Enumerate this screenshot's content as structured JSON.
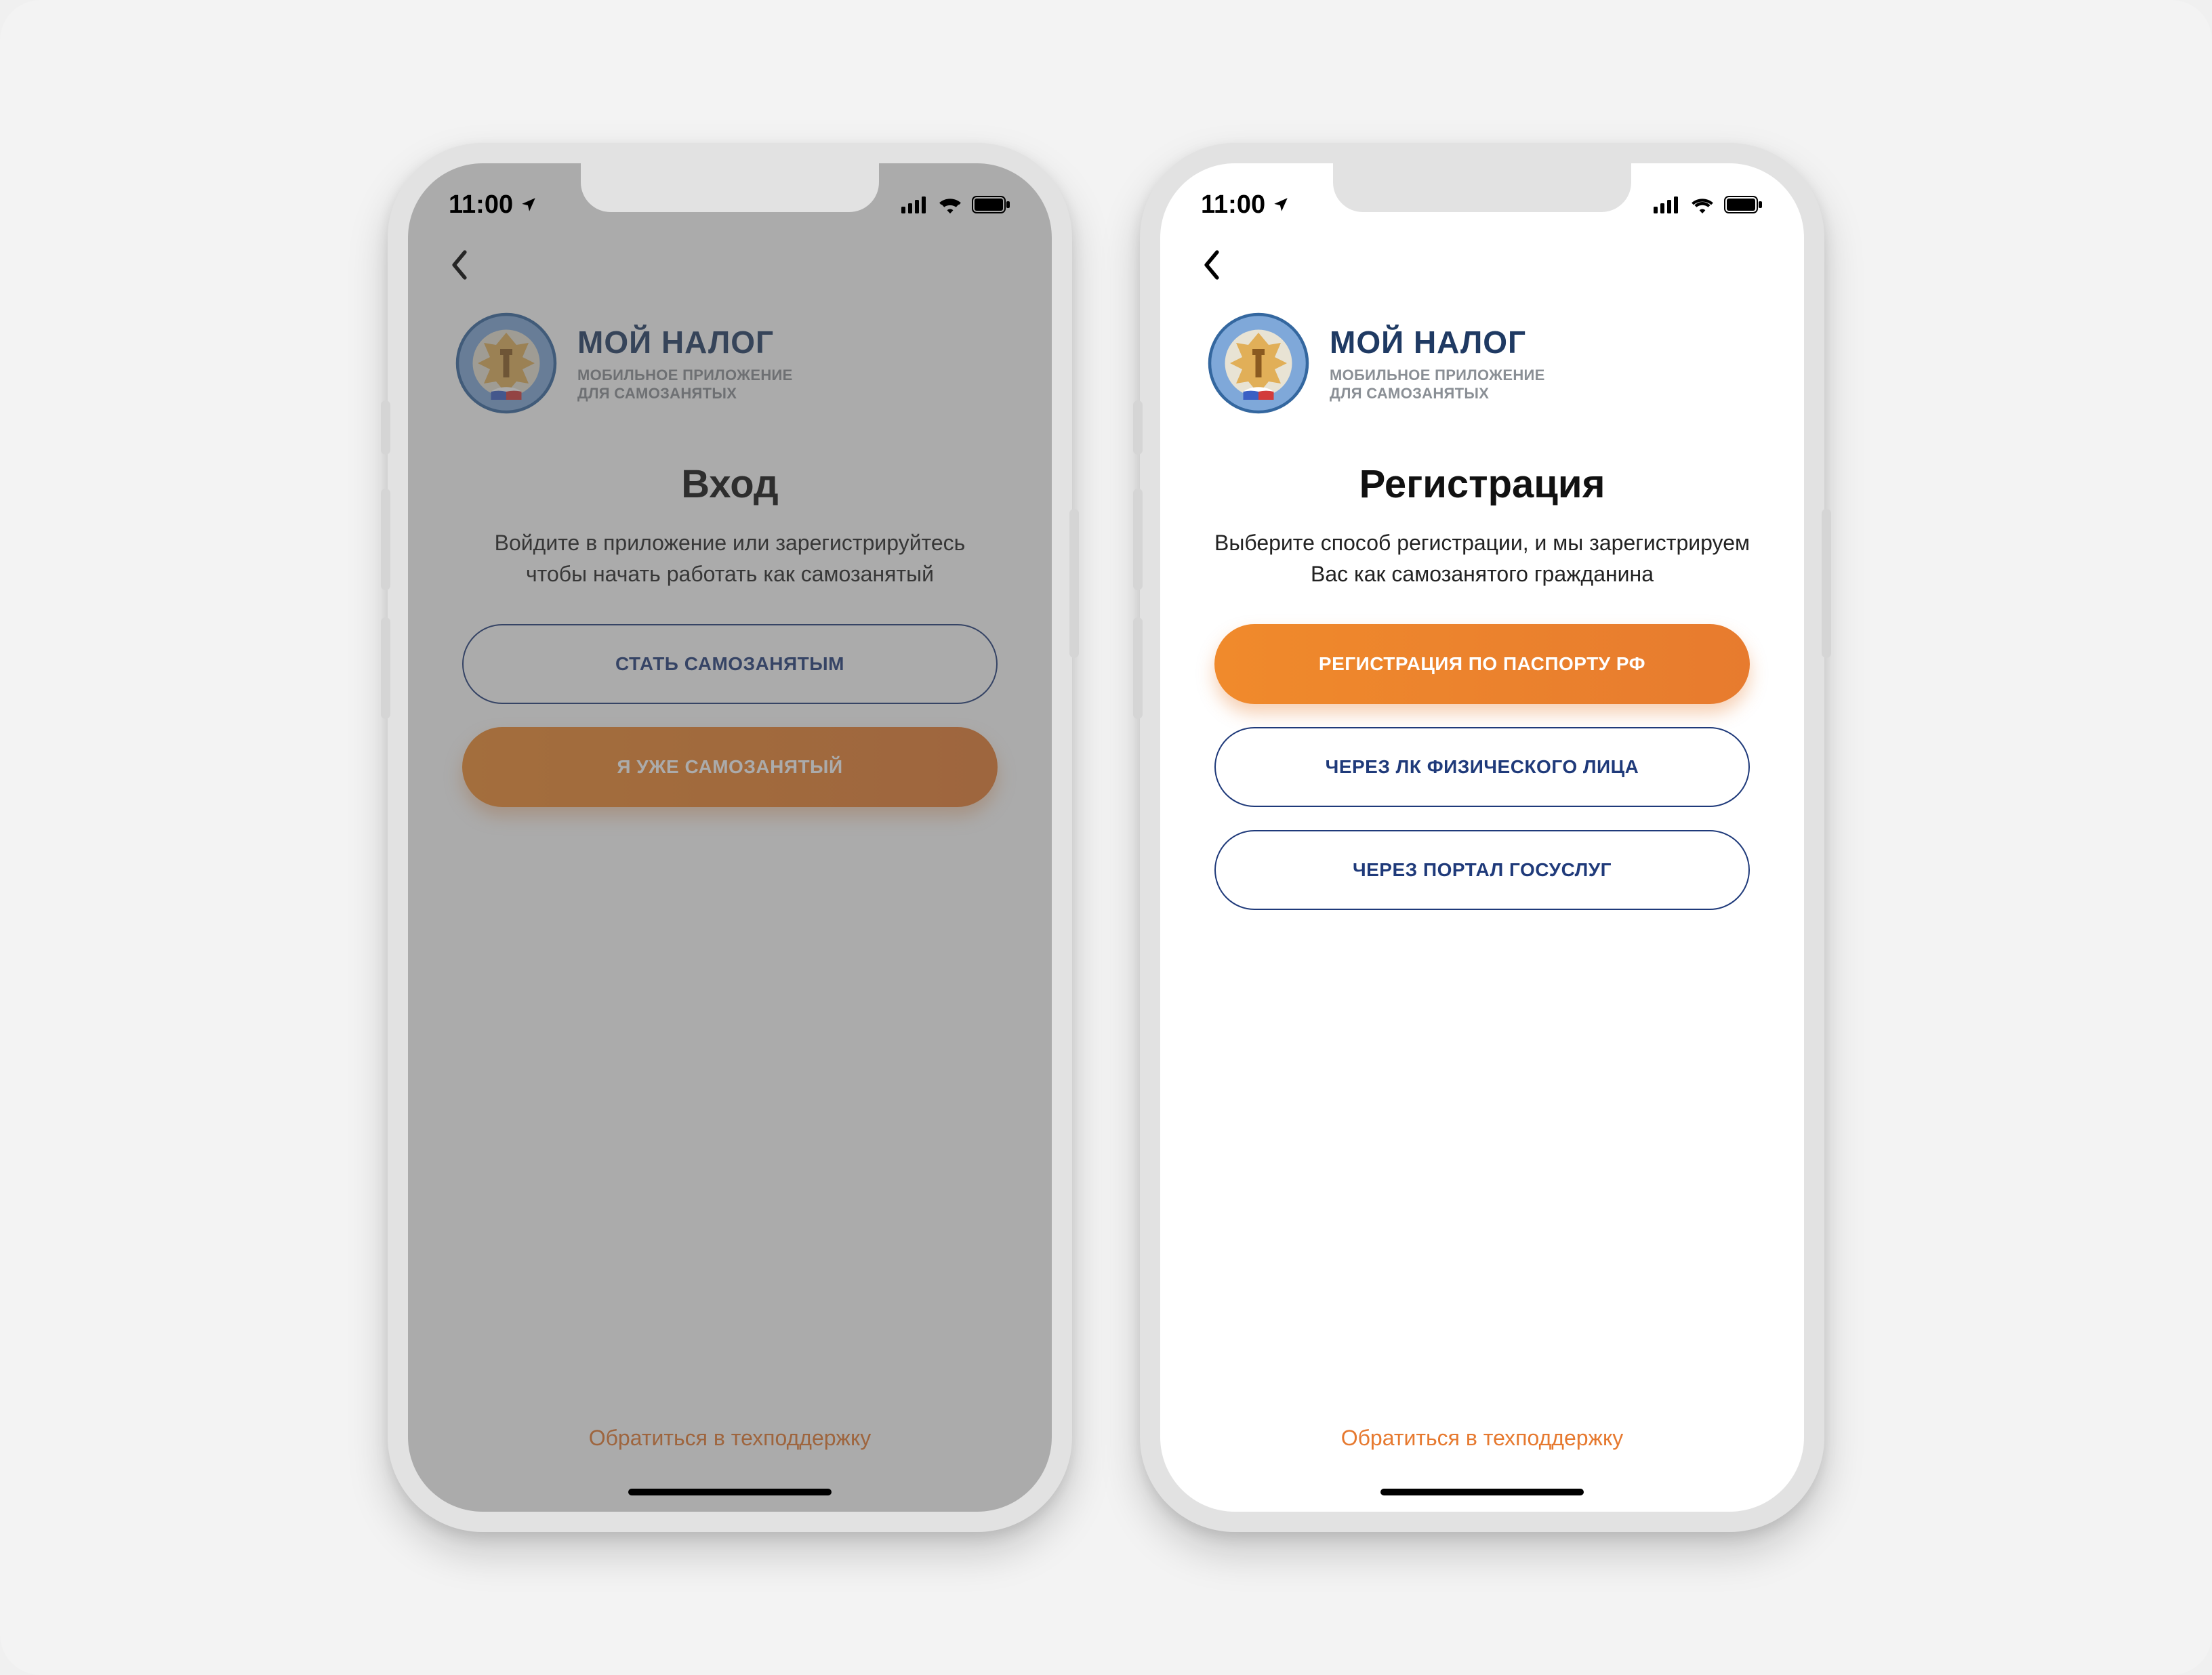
{
  "status": {
    "time": "11:00"
  },
  "brand": {
    "title": "МОЙ НАЛОГ",
    "subtitle_line1": "МОБИЛЬНОЕ ПРИЛОЖЕНИЕ",
    "subtitle_line2": "ДЛЯ САМОЗАНЯТЫХ"
  },
  "support_link": "Обратиться в техподдержку",
  "screens": {
    "login": {
      "heading": "Вход",
      "lead": "Войдите в приложение или зарегистрируйтесь чтобы начать работать как самозанятый",
      "buttons": {
        "become": "СТАТЬ САМОЗАНЯТЫМ",
        "already": "Я УЖЕ САМОЗАНЯТЫЙ"
      }
    },
    "register": {
      "heading": "Регистрация",
      "lead": "Выберите способ регистрации, и мы зарегистрируем Вас как самозанятого гражданина",
      "buttons": {
        "passport": "РЕГИСТРАЦИЯ ПО ПАСПОРТУ РФ",
        "lk": "ЧЕРЕЗ ЛК ФИЗИЧЕСКОГО ЛИЦА",
        "gosuslugi": "ЧЕРЕЗ ПОРТАЛ ГОСУСЛУГ"
      }
    }
  },
  "colors": {
    "brand_blue": "#1f3a63",
    "accent_orange": "#e6792f"
  }
}
